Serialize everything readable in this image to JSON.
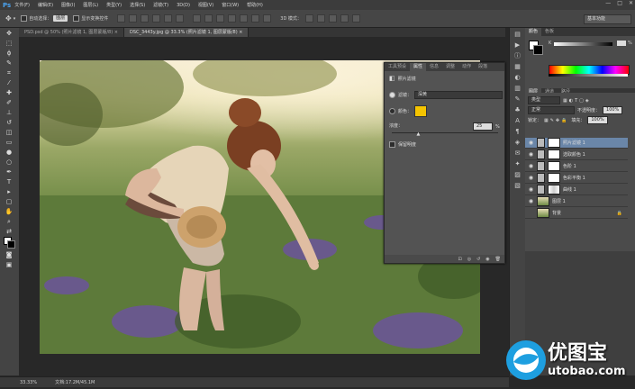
{
  "app": {
    "logo": "Ps"
  },
  "menu": [
    "文件(F)",
    "编辑(E)",
    "图像(I)",
    "图层(L)",
    "类型(Y)",
    "选择(S)",
    "滤镜(T)",
    "3D(D)",
    "视图(V)",
    "窗口(W)",
    "帮助(H)"
  ],
  "window_controls": [
    "—",
    "□",
    "✕"
  ],
  "options": {
    "auto_select_label": "自动选择：",
    "auto_select_value": "图层",
    "show_transform_label": "显示变换控件",
    "mode_3d_label": "3D 模式：",
    "workspace": "基本功能"
  },
  "tabs": [
    {
      "label": "PSD.psd @ 50% (照片滤镜 1, 图层蒙版/8) ×",
      "active": false
    },
    {
      "label": "DSC_3443y.jpg @ 33.3% (照片滤镜 1, 图层蒙版/8) ×",
      "active": true
    }
  ],
  "status": {
    "zoom": "33.33%",
    "doc": "文档:17.2M/45.1M"
  },
  "properties": {
    "tabs": [
      "工具预设",
      "属性",
      "信息",
      "调整",
      "动作",
      "段落"
    ],
    "active_tab": 1,
    "title": "照片滤镜",
    "filter_label": "滤镜：",
    "filter_value": "深黄",
    "color_label": "颜色：",
    "color_hex": "#f5c400",
    "density_label": "浓度：",
    "density_value": "25",
    "density_unit": "%",
    "density_percent": 25,
    "preserve_label": "保留明度"
  },
  "color_panel": {
    "tabs": [
      "颜色",
      "色板"
    ],
    "k_label": "K",
    "percent": "%"
  },
  "layers_panel": {
    "tabs": [
      "图层",
      "通道",
      "路径"
    ],
    "kind": "类型",
    "blend_mode": "正常",
    "opacity_label": "不透明度：",
    "opacity_value": "100%",
    "lock_label": "锁定：",
    "fill_label": "填充：",
    "fill_value": "100%",
    "layers": [
      {
        "name": "照片滤镜 1",
        "type": "adjust",
        "active": true
      },
      {
        "name": "选取颜色 1",
        "type": "adjust",
        "active": false
      },
      {
        "name": "色阶 1",
        "type": "adjust",
        "active": false
      },
      {
        "name": "色彩平衡 1",
        "type": "adjust",
        "active": false
      },
      {
        "name": "曲线 1",
        "type": "adjust",
        "active": false
      },
      {
        "name": "图层 1",
        "type": "photo",
        "active": false
      },
      {
        "name": "背景",
        "type": "photo",
        "active": false,
        "locked": true
      }
    ]
  },
  "watermark": {
    "text": "优图宝",
    "url": "utobao.com"
  }
}
